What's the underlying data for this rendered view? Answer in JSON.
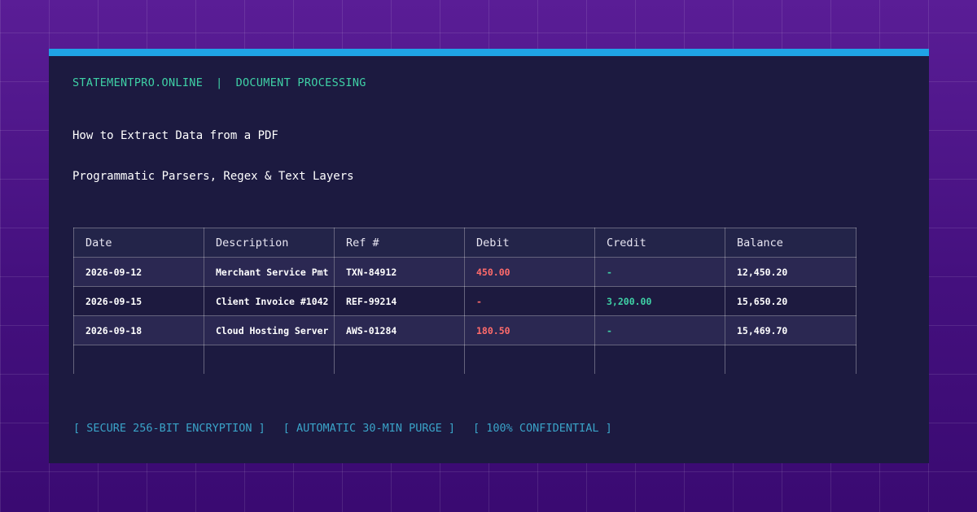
{
  "header": {
    "site": "STATEMENTPRO.ONLINE",
    "separator": "|",
    "section": "DOCUMENT PROCESSING"
  },
  "title": "How to Extract Data from a PDF",
  "subtitle": "Programmatic Parsers, Regex & Text Layers",
  "table": {
    "columns": [
      "Date",
      "Description",
      "Ref #",
      "Debit",
      "Credit",
      "Balance"
    ],
    "rows": [
      {
        "date": "2026-09-12",
        "description": "Merchant Service Pmt",
        "ref": "TXN-84912",
        "debit": "450.00",
        "credit": "-",
        "balance": "12,450.20"
      },
      {
        "date": "2026-09-15",
        "description": "Client Invoice #1042",
        "ref": "REF-99214",
        "debit": "-",
        "credit": "3,200.00",
        "balance": "15,650.20"
      },
      {
        "date": "2026-09-18",
        "description": "Cloud Hosting Server",
        "ref": "AWS-01284",
        "debit": "180.50",
        "credit": "-",
        "balance": "15,469.70"
      }
    ]
  },
  "badges": [
    "[ SECURE 256-BIT ENCRYPTION ]",
    "[ AUTOMATIC 30-MIN PURGE ]",
    "[ 100% CONFIDENTIAL ]"
  ],
  "colors": {
    "accent_bar": "#1fa3e6",
    "brand_text": "#3fd1a6",
    "debit": "#ff6b6b",
    "credit": "#3fd1a6",
    "badge_text": "#3aa3c8",
    "card_bg": "#1c1a40",
    "page_bg": "#4a1486"
  }
}
